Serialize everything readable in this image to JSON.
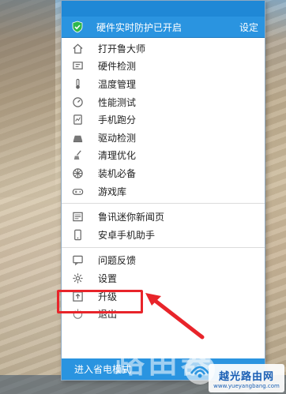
{
  "header": {
    "status_text": "硬件实时防护已开启",
    "settings_label": "设定"
  },
  "menu": {
    "section1": [
      {
        "label": "打开鲁大师",
        "icon": "home-icon"
      },
      {
        "label": "硬件检测",
        "icon": "hardware-icon"
      },
      {
        "label": "温度管理",
        "icon": "thermometer-icon"
      },
      {
        "label": "性能测试",
        "icon": "performance-icon"
      },
      {
        "label": "手机跑分",
        "icon": "phone-benchmark-icon"
      },
      {
        "label": "驱动检测",
        "icon": "driver-icon"
      },
      {
        "label": "清理优化",
        "icon": "broom-icon"
      },
      {
        "label": "装机必备",
        "icon": "essentials-icon"
      },
      {
        "label": "游戏库",
        "icon": "gamepad-icon"
      }
    ],
    "section2": [
      {
        "label": "鲁讯迷你新闻页",
        "icon": "news-icon"
      },
      {
        "label": "安卓手机助手",
        "icon": "android-phone-icon"
      }
    ],
    "section3": [
      {
        "label": "问题反馈",
        "icon": "feedback-icon"
      },
      {
        "label": "设置",
        "icon": "gear-icon"
      },
      {
        "label": "升级",
        "icon": "upgrade-icon"
      },
      {
        "label": "退出",
        "icon": "power-icon"
      }
    ]
  },
  "footer": {
    "label": "进入省电模式"
  },
  "watermark": {
    "text": "路由器",
    "site_name": "越光路由网",
    "site_url": "www.yueyangbang.com"
  },
  "colors": {
    "accent_blue": "#2a94e0",
    "highlight_red": "#e8242a"
  }
}
